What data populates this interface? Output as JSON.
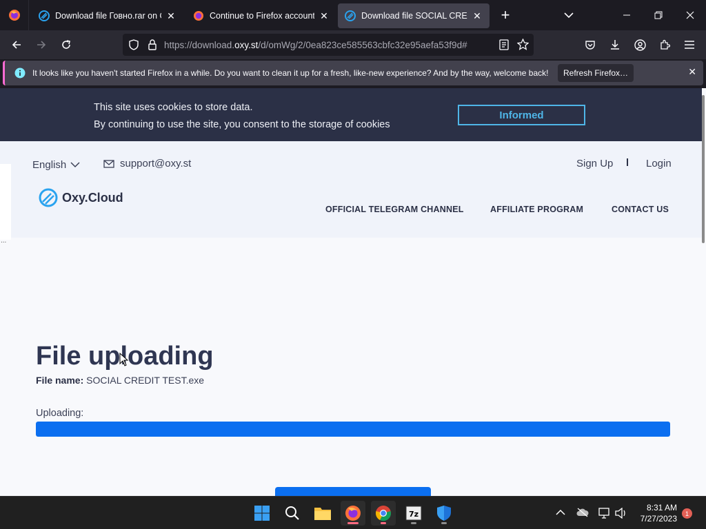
{
  "tabs": [
    {
      "title": "Download file Говно.rar on Oxy",
      "favicon": "oxy-favicon",
      "active": false
    },
    {
      "title": "Continue to Firefox accounts",
      "favicon": "firefox-favicon",
      "active": false
    },
    {
      "title": "Download file SOCIAL CREDIT T",
      "favicon": "oxy-favicon",
      "active": true
    }
  ],
  "url": {
    "prefix": "https://download.",
    "domain": "oxy.st",
    "suffix": "/d/omWg/2/0ea823ce585563cbfc32e95aefa53f9d#"
  },
  "notification": {
    "text": "It looks like you haven't started Firefox in a while. Do you want to clean it up for a fresh, like-new experience? And by the way, welcome back!",
    "button": "Refresh Firefox…"
  },
  "cookie": {
    "line1": "This site uses cookies to store data.",
    "line2": "By continuing to use the site, you consent to the storage of cookies",
    "button": "Informed"
  },
  "header": {
    "language": "English",
    "email": "support@oxy.st",
    "signup": "Sign Up",
    "separator": "I",
    "login": "Login",
    "logo": "Oxy.Cloud",
    "nav": [
      "OFFICIAL TELEGRAM CHANNEL",
      "AFFILIATE PROGRAM",
      "CONTACT US"
    ]
  },
  "main": {
    "heading": "File uploading",
    "file_label": "File name:",
    "file_name": "SOCIAL CREDIT TEST.exe",
    "uploading_label": "Uploading:",
    "progress_percent": 100
  },
  "side": {
    "dots": "..."
  },
  "taskbar": {
    "time": "8:31 AM",
    "date": "7/27/2023",
    "badge": "1"
  },
  "colors": {
    "accent": "#0b6ff0",
    "cookie_bg": "#2b3046",
    "informed_border": "#4fb6e8",
    "heading": "#2f3652"
  }
}
